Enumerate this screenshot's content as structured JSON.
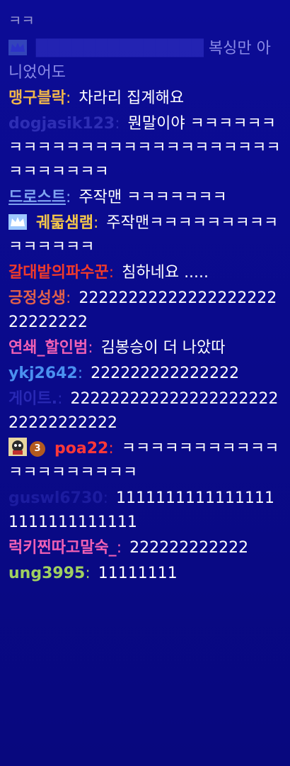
{
  "messages": [
    {
      "nick": "",
      "text": "ㅋㅋ"
    },
    {
      "nick": "",
      "text": "복싱만 아니었어도",
      "nick_color": "#6a6ae6",
      "badge": "crown"
    },
    {
      "nick": "맹구블락",
      "text": "차라리 집계해요",
      "nick_color": "#f0b64a"
    },
    {
      "nick": "dogjasik123",
      "text": "뭔말이야 ㅋㅋㅋㅋㅋㅋㅋㅋㅋㅋㅋㅋㅋㅋㅋㅋㅋㅋㅋㅋㅋㅋㅋㅋㅋㅋㅋㅋㅋㅋㅋㅋ",
      "nick_color": "#5a5ad8"
    },
    {
      "nick": "드로스트",
      "text": "주작맨 ㅋㅋㅋㅋㅋㅋㅋ",
      "nick_color": "#7ea2f0"
    },
    {
      "nick": "궤둛샘램",
      "text": "주작맨ㅋㅋㅋㅋㅋㅋㅋㅋㅋㅋㅋㅋㅋㅋㅋ",
      "nick_color": "#f4c64a",
      "badge": "crown"
    },
    {
      "nick": "갈대밭의파수꾼",
      "text": "침하네요 .....",
      "nick_color": "#f03a2a"
    },
    {
      "nick": "긍정성생",
      "text": "2222222222222222222222222222",
      "nick_color": "#e0604a"
    },
    {
      "nick": "연쇄_할인범",
      "text": "김봉승이 더 나았따",
      "nick_color": "#f060b4"
    },
    {
      "nick": "ykj2642",
      "text": "222222222222222",
      "nick_color": "#4a90f0"
    },
    {
      "nick": "게이트.",
      "text": "22222222222222222222222222222222",
      "nick_color": "#4848d0"
    },
    {
      "nick": "poa22",
      "text": "ㅋㅋㅋㅋㅋㅋㅋㅋㅋㅋㅋㅋㅋㅋㅋㅋㅋㅋㅋㅋ",
      "nick_color": "#ff3838",
      "badge_number": "3"
    },
    {
      "nick": "guswl6730",
      "text": "11111111111111111111111111111",
      "nick_color": "#2a2ab0"
    },
    {
      "nick": "럭키찐따고말숙_",
      "text": "222222222222",
      "nick_color": "#f060b4"
    },
    {
      "nick": "ung3995",
      "text": "11111111",
      "nick_color": "#a0d060"
    }
  ]
}
